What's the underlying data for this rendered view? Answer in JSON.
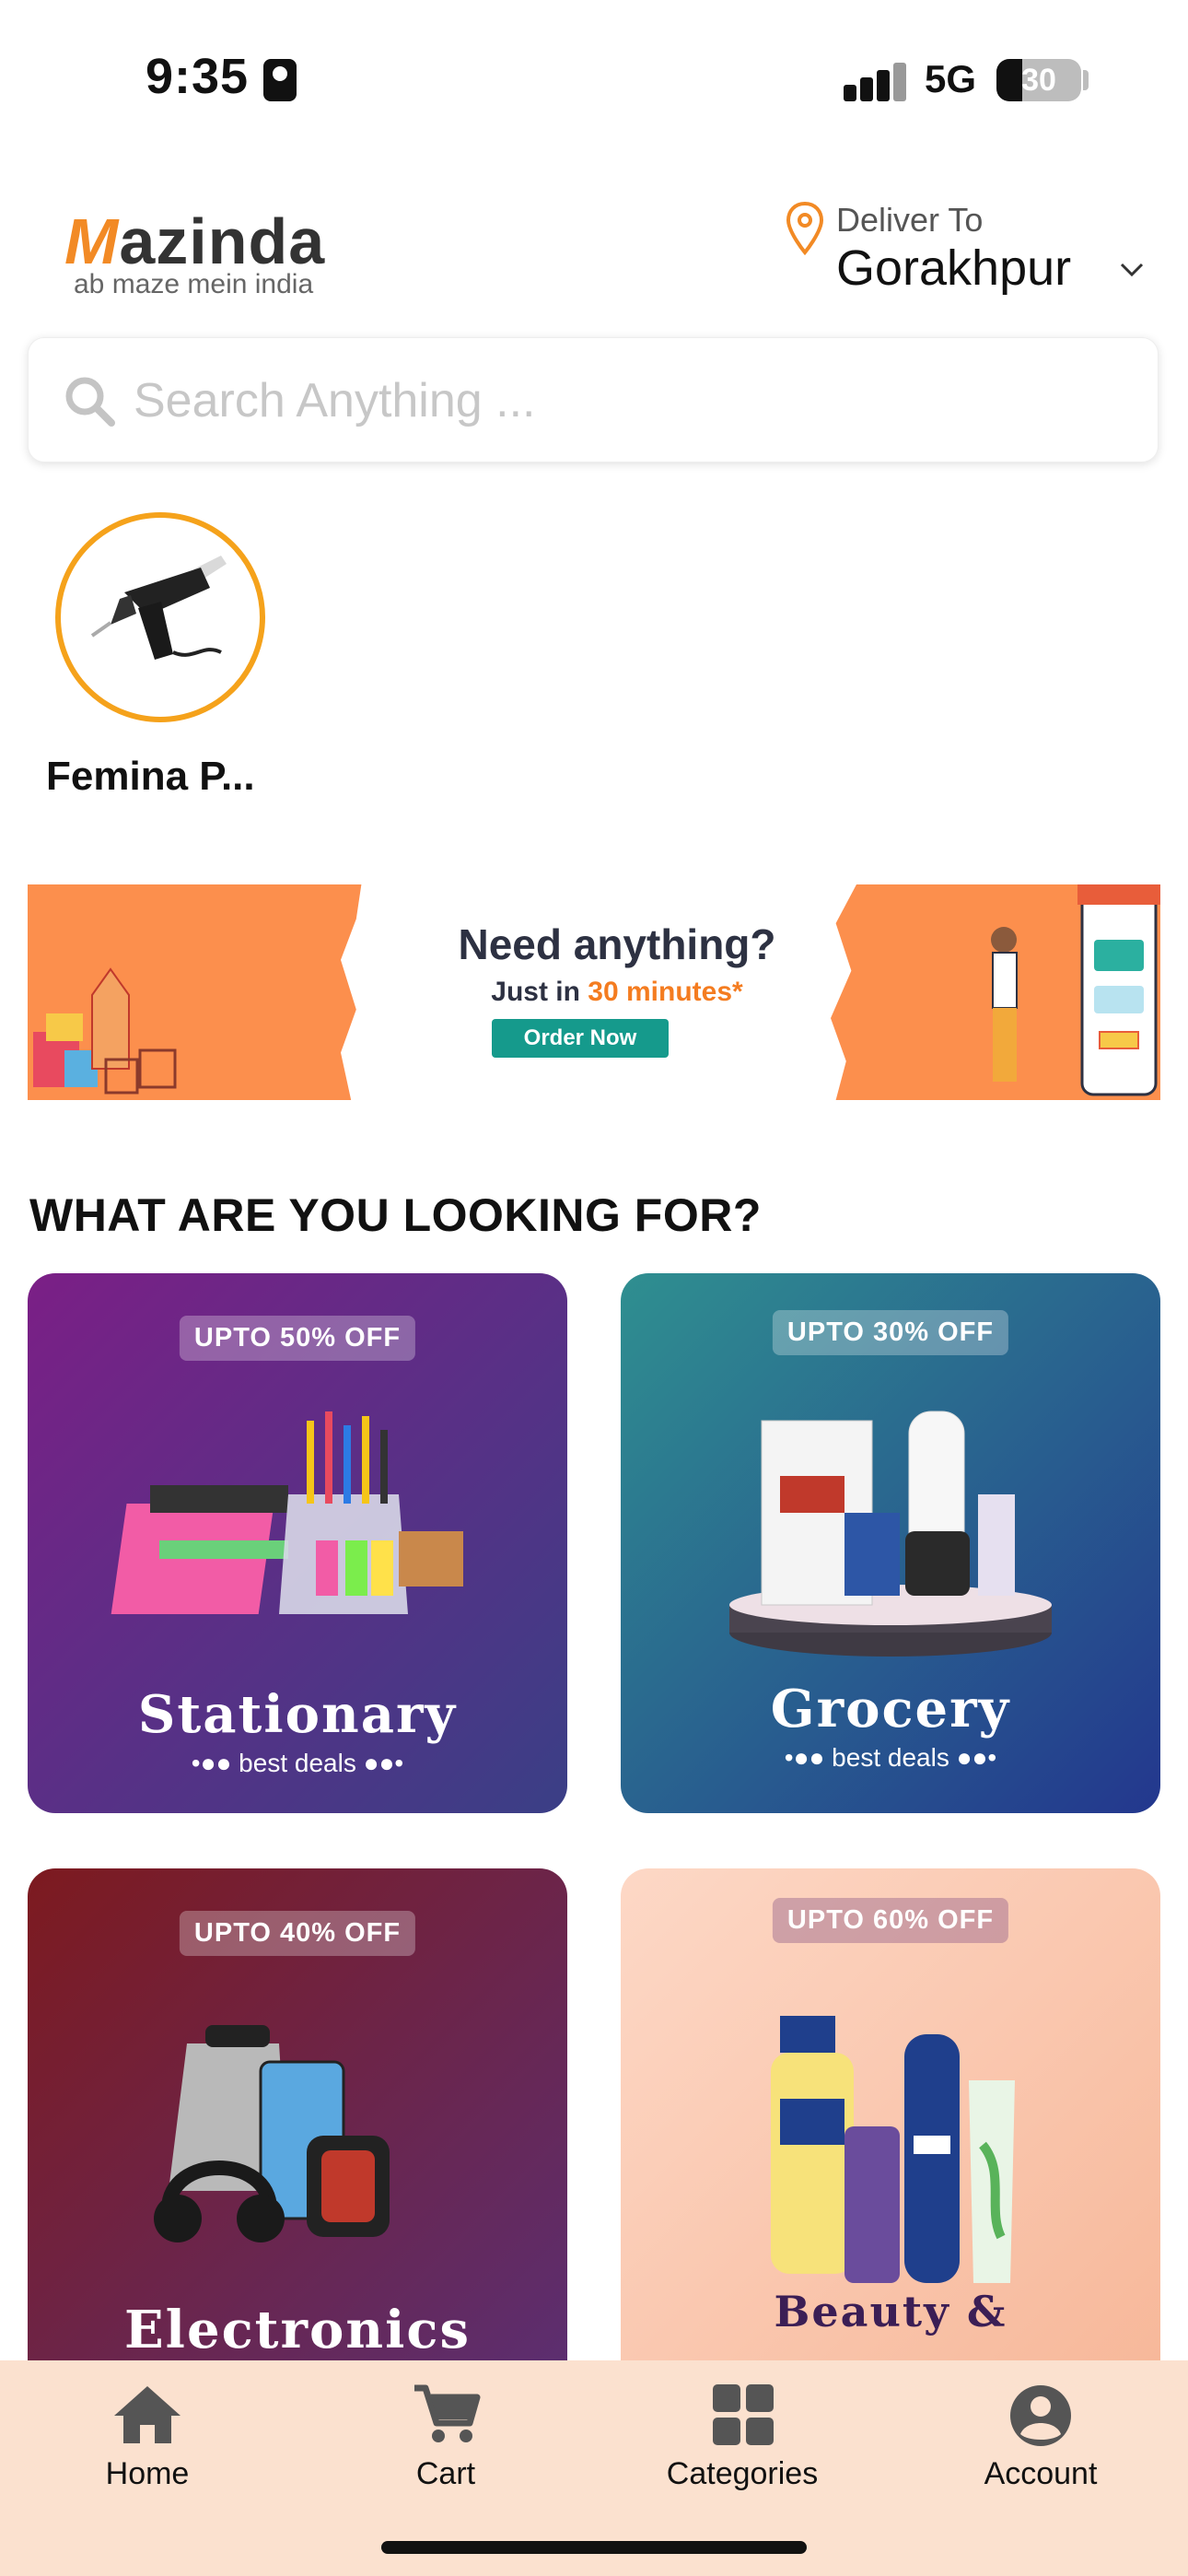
{
  "status_bar": {
    "time": "9:35",
    "network": "5G",
    "battery": "30"
  },
  "header": {
    "logo_name": "mazinda",
    "logo_initial": "M",
    "logo_rest": "azinda",
    "logo_tagline": "ab maze mein india",
    "deliver_label": "Deliver To",
    "deliver_city": "Gorakhpur"
  },
  "search": {
    "placeholder": "Search Anything ..."
  },
  "stores": [
    {
      "name": "Femina P..."
    }
  ],
  "banner": {
    "title": "Need anything?",
    "subtitle_prefix": "Just in ",
    "subtitle_highlight": "30 minutes*",
    "button": "Order Now"
  },
  "section_title": "WHAT ARE YOU LOOKING FOR?",
  "categories": [
    {
      "badge": "UPTO 50% OFF",
      "title": "Stationary",
      "sub": "•●● best deals ●●•"
    },
    {
      "badge": "UPTO 30% OFF",
      "title": "Grocery",
      "sub": "•●● best deals ●●•"
    },
    {
      "badge": "UPTO 40% OFF",
      "title": "Electronics"
    },
    {
      "badge": "UPTO 60% OFF",
      "title": "Beauty &"
    }
  ],
  "nav": [
    {
      "label": "Home",
      "icon": "home-icon"
    },
    {
      "label": "Cart",
      "icon": "cart-icon"
    },
    {
      "label": "Categories",
      "icon": "grid-icon"
    },
    {
      "label": "Account",
      "icon": "account-icon"
    }
  ],
  "colors": {
    "accent": "#f5a21b",
    "banner": "#fc8f4d",
    "nav_bg": "#fbe1cf",
    "order_button": "#159a8c"
  }
}
